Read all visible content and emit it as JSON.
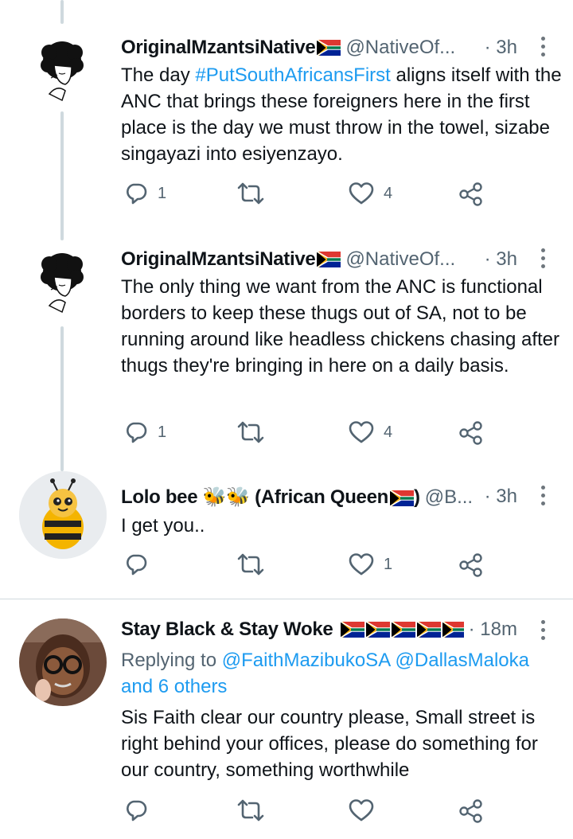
{
  "tweets": [
    {
      "name": "OriginalMzantsiNative",
      "handle": "@NativeOf...",
      "time": "· 3h",
      "text_pre": "The day ",
      "hashtag": "#PutSouthAfricansFirst",
      "text_post": " aligns itself with the ANC that brings these foreigners here in the first place is the day we must throw in the towel, sizabe singayazi into esiyenzayo.",
      "replies": "1",
      "retweets": "",
      "likes": "4"
    },
    {
      "name": "OriginalMzantsiNative",
      "handle": "@NativeOf...",
      "time": "· 3h",
      "text": "The only thing we want from the ANC is functional borders to keep these thugs out of SA, not to be running around like headless chickens chasing after thugs they're bringing in here on a daily basis.",
      "replies": "1",
      "retweets": "",
      "likes": "4"
    },
    {
      "name_pre": "Lolo bee ",
      "name_emoji": "🐝🐝",
      "name_post": " (African Queen",
      "name_close": ")",
      "handle": "@B...",
      "time": "· 3h",
      "text": "I get you..",
      "replies": "",
      "retweets": "",
      "likes": "1"
    },
    {
      "name": "Stay Black & Stay Woke",
      "time": "· 18m",
      "replying_label": "Replying to",
      "replying_to": "@FaithMazibukoSA @DallasMaloka",
      "replying_more": "and 6 others",
      "text": "Sis Faith clear our country please, Small street is right behind your offices, please do something for our country, something worthwhile",
      "replies": "",
      "retweets": "",
      "likes": ""
    }
  ],
  "icons": {
    "reply": "reply-icon",
    "retweet": "retweet-icon",
    "like": "heart-icon",
    "share": "share-icon",
    "more": "more-vertical-icon",
    "flag": "south-africa-flag-icon"
  },
  "colors": {
    "link": "#1d9bf0",
    "secondary_text": "#536471",
    "thread_line": "#cfd9de"
  }
}
